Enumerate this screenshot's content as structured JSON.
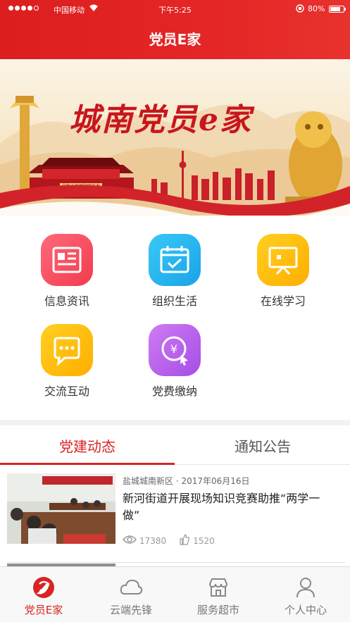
{
  "status_bar": {
    "carrier": "中国移动",
    "time": "下午5:25",
    "battery": "80%",
    "battery_level": 0.8
  },
  "header": {
    "title": "党员E家"
  },
  "banner": {
    "title": "城南党员e家",
    "plaque": "中华人民共和国万岁"
  },
  "grid": {
    "items": [
      {
        "label": "信息资讯",
        "icon": "newspaper-icon",
        "colors": [
          "#ff6a7a",
          "#f23b4e"
        ]
      },
      {
        "label": "组织生活",
        "icon": "calendar-check-icon",
        "colors": [
          "#38c9f5",
          "#1aa3ea"
        ]
      },
      {
        "label": "在线学习",
        "icon": "presentation-board-icon",
        "colors": [
          "#ffd021",
          "#ffae00"
        ]
      },
      {
        "label": "交流互动",
        "icon": "chat-bubble-icon",
        "colors": [
          "#ffd021",
          "#ffae00"
        ]
      },
      {
        "label": "党费缴纳",
        "icon": "yuan-payment-icon",
        "colors": [
          "#cf7bf2",
          "#a54ee6"
        ]
      }
    ]
  },
  "news": {
    "tabs": [
      {
        "label": "党建动态",
        "active": true
      },
      {
        "label": "通知公告",
        "active": false
      }
    ],
    "items": [
      {
        "meta": "盐城城南新区 · 2017年06月16日",
        "headline": "新河街道开展现场知识竞赛助推“两学一做”",
        "views": "17380",
        "likes": "1520"
      }
    ]
  },
  "tabbar": {
    "items": [
      {
        "label": "党员E家",
        "icon": "party-emblem-icon",
        "active": true
      },
      {
        "label": "云端先锋",
        "icon": "cloud-icon",
        "active": false
      },
      {
        "label": "服务超市",
        "icon": "store-icon",
        "active": false
      },
      {
        "label": "个人中心",
        "icon": "user-icon",
        "active": false
      }
    ]
  },
  "colors": {
    "primary": "#d92323",
    "tab_inactive": "#777777"
  }
}
